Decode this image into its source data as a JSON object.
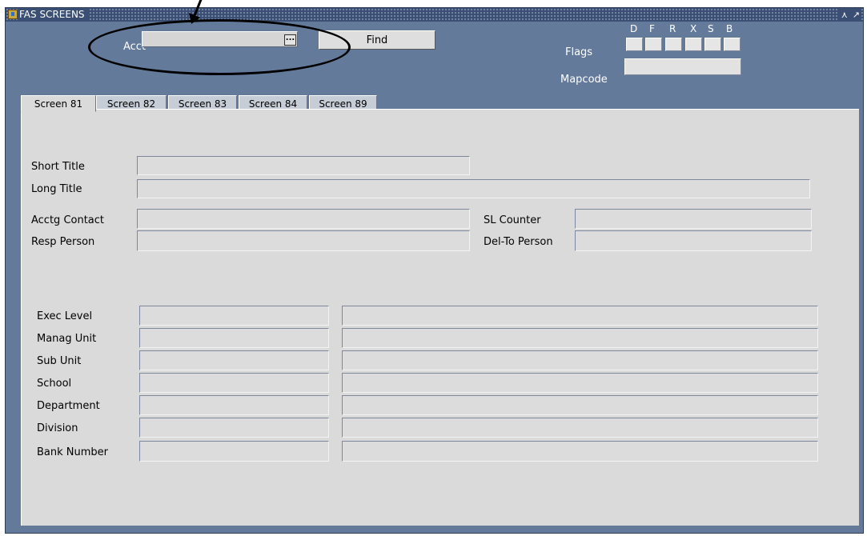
{
  "window": {
    "title": "FAS SCREENS",
    "controls": [
      "minimize-icon",
      "maximize-icon"
    ]
  },
  "header": {
    "acct_label": "Acct",
    "acct_value": "",
    "lov_button_label": "...",
    "find_button": "Find",
    "flags_label": "Flags",
    "flag_letters": [
      "D",
      "F",
      "R",
      "X",
      "S",
      "B"
    ],
    "mapcode_label": "Mapcode",
    "mapcode_value": ""
  },
  "tabs": [
    {
      "label": "Screen 81",
      "active": true
    },
    {
      "label": "Screen 82",
      "active": false
    },
    {
      "label": "Screen 83",
      "active": false
    },
    {
      "label": "Screen 84",
      "active": false
    },
    {
      "label": "Screen 89",
      "active": false
    }
  ],
  "form": {
    "short_title": "Short Title",
    "long_title": "Long Title",
    "acctg_contact": "Acctg Contact",
    "resp_person": "Resp Person",
    "sl_counter": "SL Counter",
    "del_to_person": "Del-To Person",
    "hierarchy": [
      "Exec Level",
      "Manag Unit",
      "Sub Unit",
      "School",
      "Department",
      "Division",
      "Bank Number"
    ]
  },
  "annotation": {
    "color": "#000000"
  },
  "colors": {
    "window_bg": "#647a9b",
    "titlebar_bg": "#3b4f74",
    "panel_bg": "#dadada",
    "field_bg": "#dcdcdc"
  }
}
